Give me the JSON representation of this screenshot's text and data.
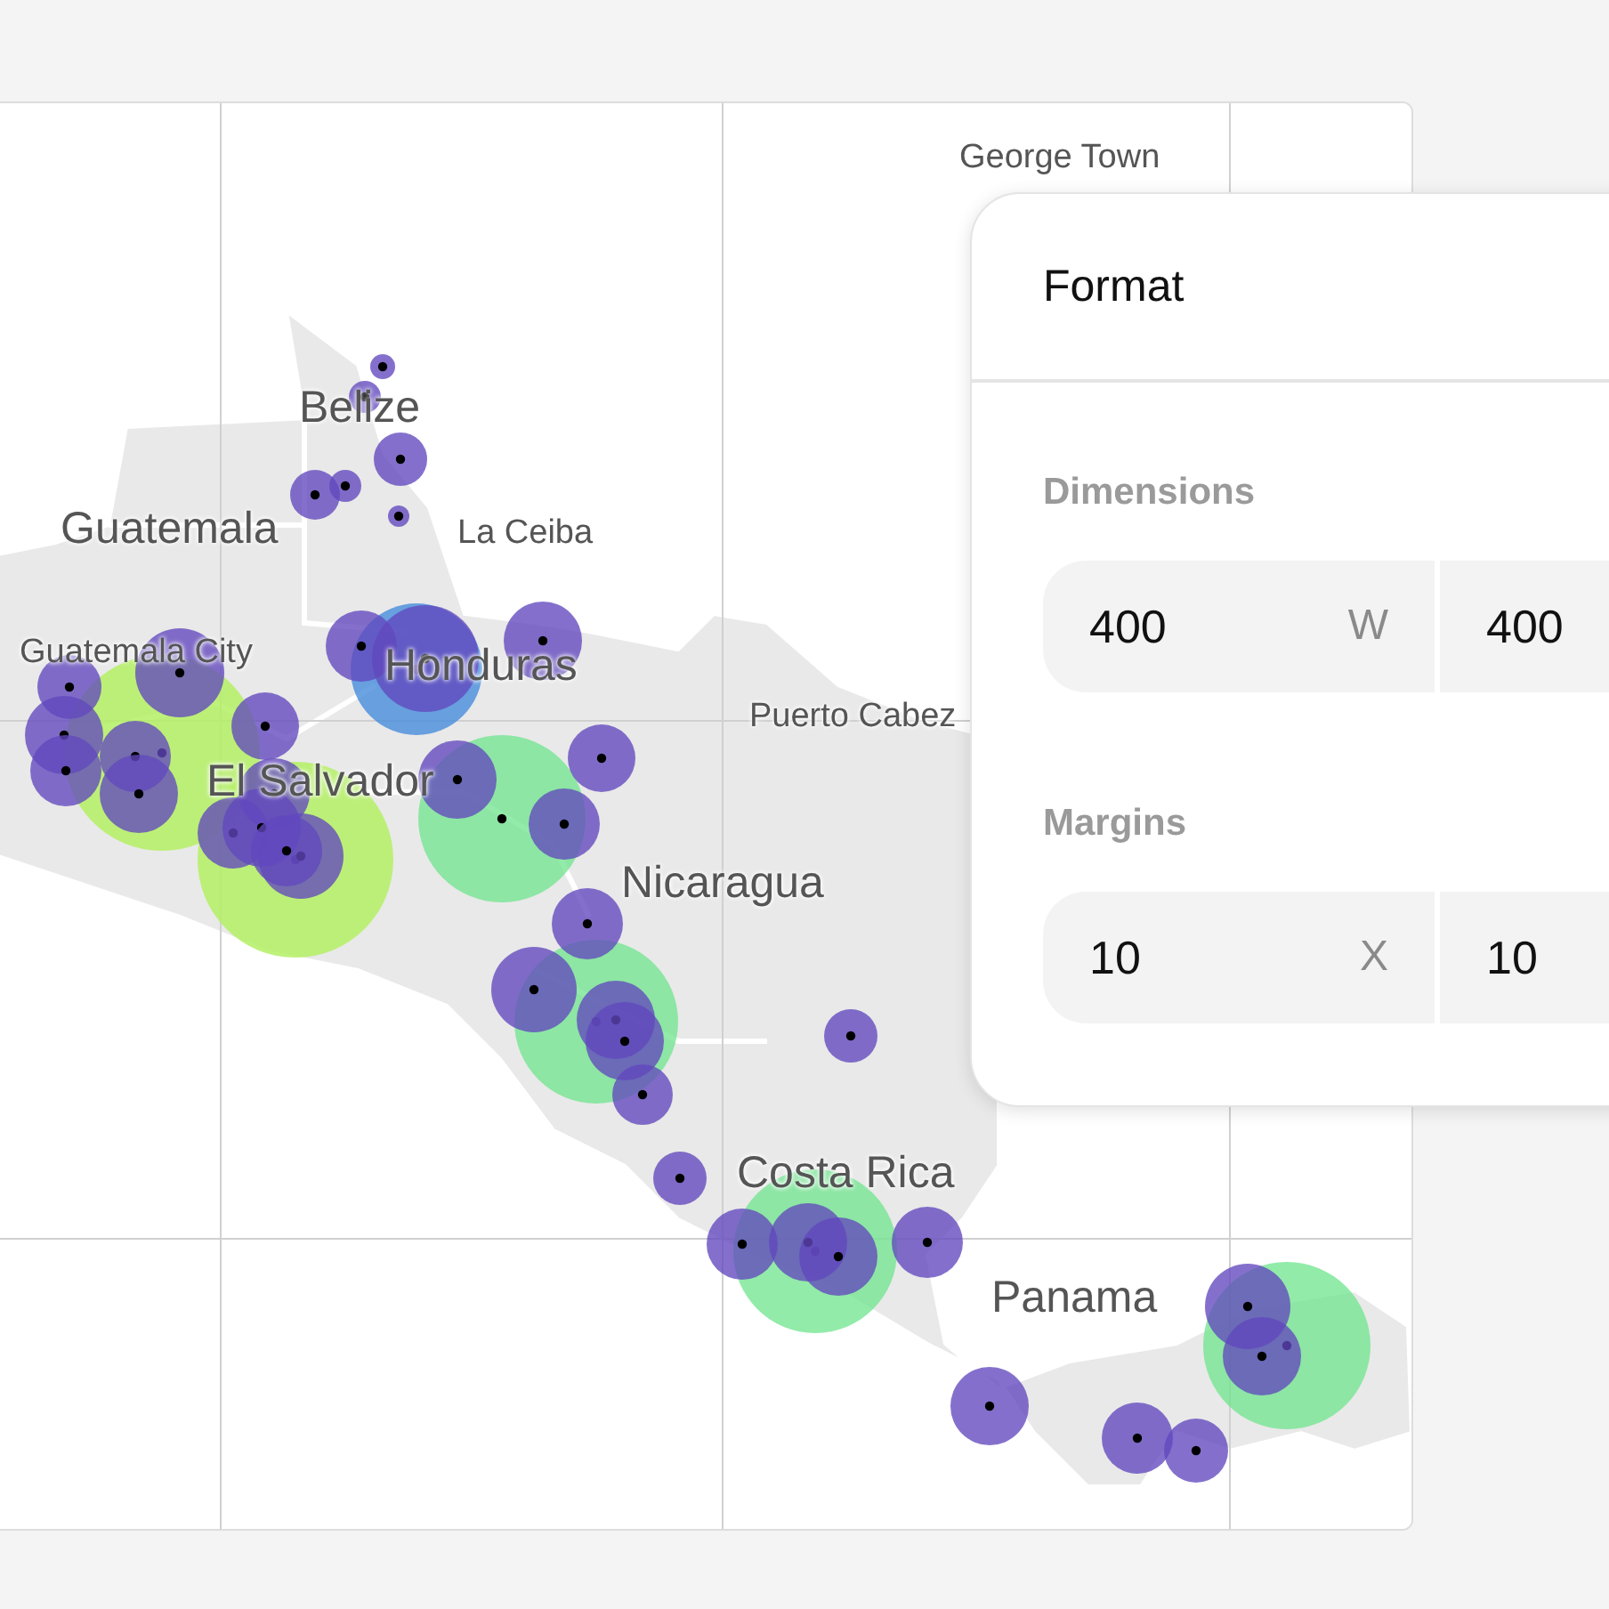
{
  "map": {
    "labels": [
      {
        "text": "George Town",
        "kind": "city"
      },
      {
        "text": "Belize",
        "kind": "country"
      },
      {
        "text": "Guatemala",
        "kind": "country"
      },
      {
        "text": "La Ceiba",
        "kind": "city"
      },
      {
        "text": "Guatemala City",
        "kind": "city"
      },
      {
        "text": "Honduras",
        "kind": "country"
      },
      {
        "text": "Puerto Cabez",
        "kind": "city"
      },
      {
        "text": "El Salvador",
        "kind": "country"
      },
      {
        "text": "Nicaragua",
        "kind": "country"
      },
      {
        "text": "Costa Rica",
        "kind": "country"
      },
      {
        "text": "Panama",
        "kind": "country"
      }
    ]
  },
  "format_panel": {
    "title": "Format",
    "sections": [
      {
        "label": "Dimensions",
        "fields": [
          {
            "value": "400",
            "unit": "W"
          },
          {
            "value": "400"
          }
        ]
      },
      {
        "label": "Margins",
        "fields": [
          {
            "value": "10",
            "unit": "X"
          },
          {
            "value": "10"
          }
        ]
      }
    ]
  }
}
